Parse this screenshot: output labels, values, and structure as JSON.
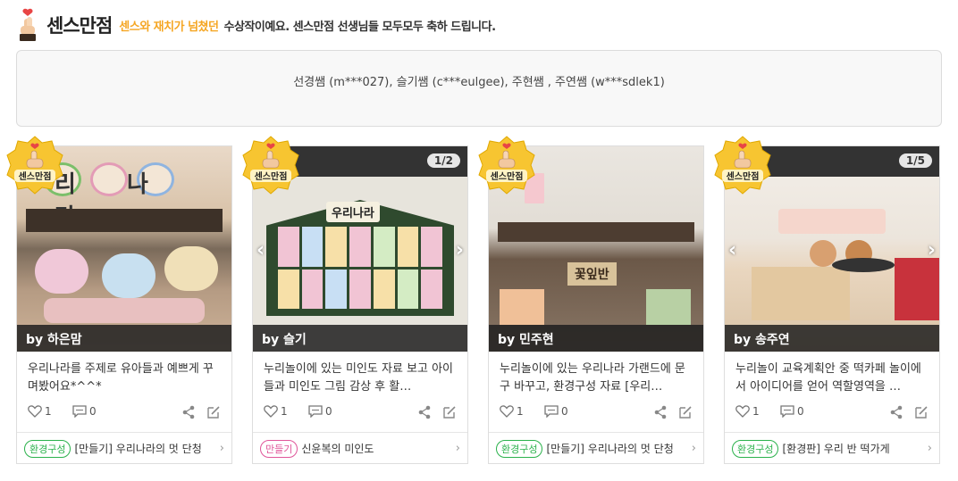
{
  "header": {
    "brand": "센스만점",
    "highlight": "센스와 재치가 넘쳤던",
    "rest": "수상작이예요. 센스만점 선생님들 모두모두 축하 드립니다."
  },
  "winners": {
    "text": "선경쌤 (m***027), 슬기쌤 (c***eulgee), 주현쌤 , 주연쌤 (w***sdlek1)"
  },
  "badge_label": "센스만점",
  "cards": [
    {
      "author": "by 하은맘",
      "counter": "",
      "description": "우리나라를 주제로 유아들과 예쁘게 꾸며봤어요*^^*",
      "likes": "1",
      "comments": "0",
      "tag": "환경구성",
      "title": "[만들기] 우리나라의 멋 단청",
      "thumb_text": "리 나 라"
    },
    {
      "author": "by 슬기",
      "counter": "1/2",
      "description": "누리놀이에 있는 미인도 자료 보고 아이들과 미인도 그림 감상 후 활…",
      "likes": "1",
      "comments": "0",
      "tag": "만들기",
      "title": "신윤복의 미인도",
      "thumb_text": "우리나라"
    },
    {
      "author": "by 민주현",
      "counter": "",
      "description": "누리놀이에 있는 우리나라 가랜드에 문구 바꾸고, 환경구성 자료 [우리…",
      "likes": "1",
      "comments": "0",
      "tag": "환경구성",
      "title": "[만들기] 우리나라의 멋 단청",
      "thumb_text": "꽃잎반"
    },
    {
      "author": "by 송주연",
      "counter": "1/5",
      "description": "누리놀이 교육계획안 중 떡카페 놀이에서 아이디어를 얻어 역할영역을 …",
      "likes": "1",
      "comments": "0",
      "tag": "환경구성",
      "title": "[환경판] 우리 반 떡가게",
      "thumb_text": ""
    }
  ],
  "colors": {
    "accent": "#f5a623",
    "tag_green": "#2bb24c",
    "tag_pink": "#e0569a"
  },
  "icons": [
    "finger-heart-icon",
    "heart-icon",
    "comment-icon",
    "share-icon",
    "write-icon",
    "chevron-right-icon",
    "arrow-left-icon",
    "arrow-right-icon"
  ]
}
